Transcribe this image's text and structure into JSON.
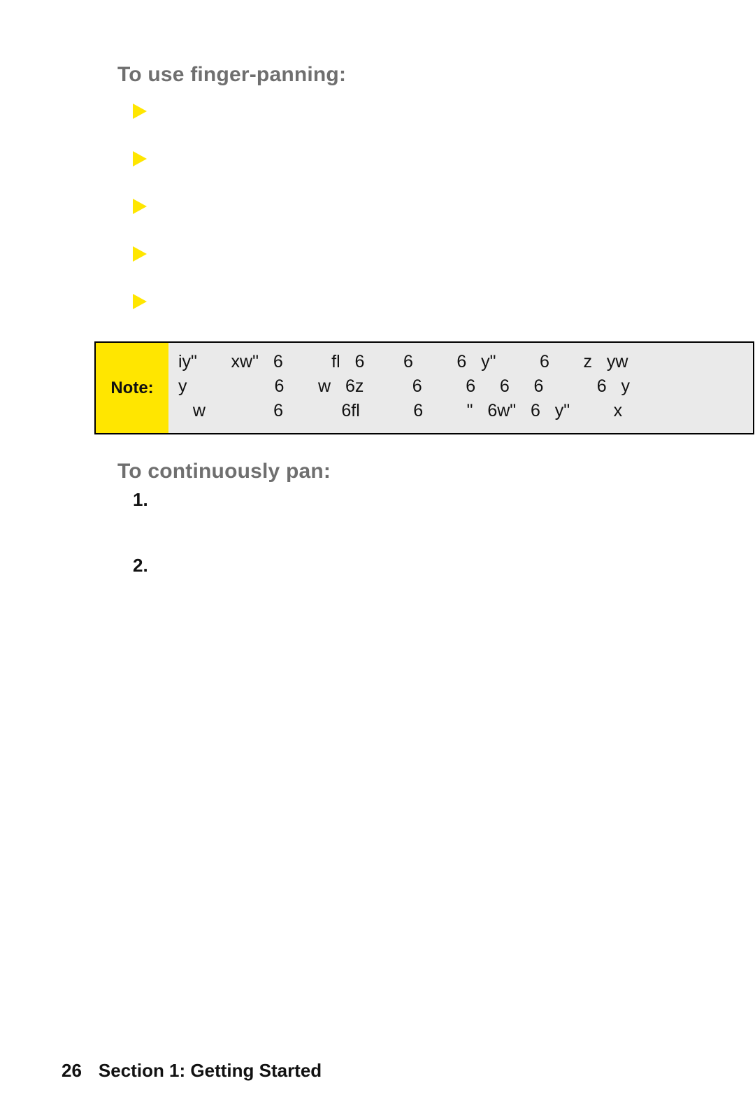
{
  "headings": {
    "finger_panning": "To use finger-panning:",
    "continuously_pan": "To continuously pan:"
  },
  "note": {
    "label": "Note:",
    "line1": "iy\"       xw\"   6          fl   6        6         6   y\"         6       z   yw",
    "line2": "y                  6       w   6z          6         6     6     6           6   y",
    "line3": "   w              6            6fl           6         \"   6w\"   6   y\"         x"
  },
  "numbers": {
    "one": "1.",
    "two": "2."
  },
  "footer": {
    "page": "26",
    "section": "Section 1: Getting Started"
  }
}
